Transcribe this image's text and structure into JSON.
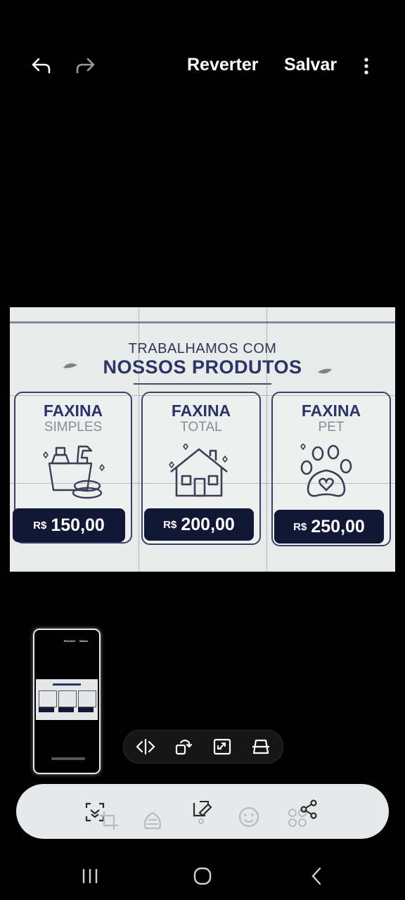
{
  "top_bar": {
    "undo_icon": "undo-arrow-icon",
    "redo_icon": "redo-arrow-icon",
    "revert_label": "Reverter",
    "save_label": "Salvar",
    "more_icon": "more-vertical-icon"
  },
  "photo": {
    "heading_small": "TRABALHAMOS COM",
    "heading_large": "NOSSOS PRODUTOS",
    "cards": [
      {
        "title": "FAXINA",
        "subtitle": "SIMPLES",
        "icon": "cleaning-products-icon",
        "currency": "R$",
        "price": "150,00"
      },
      {
        "title": "FAXINA",
        "subtitle": "TOTAL",
        "icon": "house-icon",
        "currency": "R$",
        "price": "200,00"
      },
      {
        "title": "FAXINA",
        "subtitle": "PET",
        "icon": "paw-heart-icon",
        "currency": "R$",
        "price": "250,00"
      }
    ]
  },
  "thumbnail": {
    "mini_revert": "Reverter",
    "mini_save": "Salvar"
  },
  "tools": {
    "items": [
      "flip-icon",
      "rotate-icon",
      "expand-icon",
      "perspective-icon"
    ]
  },
  "bottom_bar": {
    "items": [
      "auto-select-icon",
      "crop-icon",
      "filter-icon",
      "adjust-draw-icon",
      "sticker-emoji-icon",
      "more-tools-icon",
      "share-icon"
    ]
  },
  "nav_bar": {
    "items": [
      "recent-apps-icon",
      "home-icon",
      "back-icon"
    ]
  },
  "colors": {
    "brand_navy": "#2a3567",
    "price_bg": "#111836",
    "bottom_bar_bg": "#e6e9e9"
  }
}
